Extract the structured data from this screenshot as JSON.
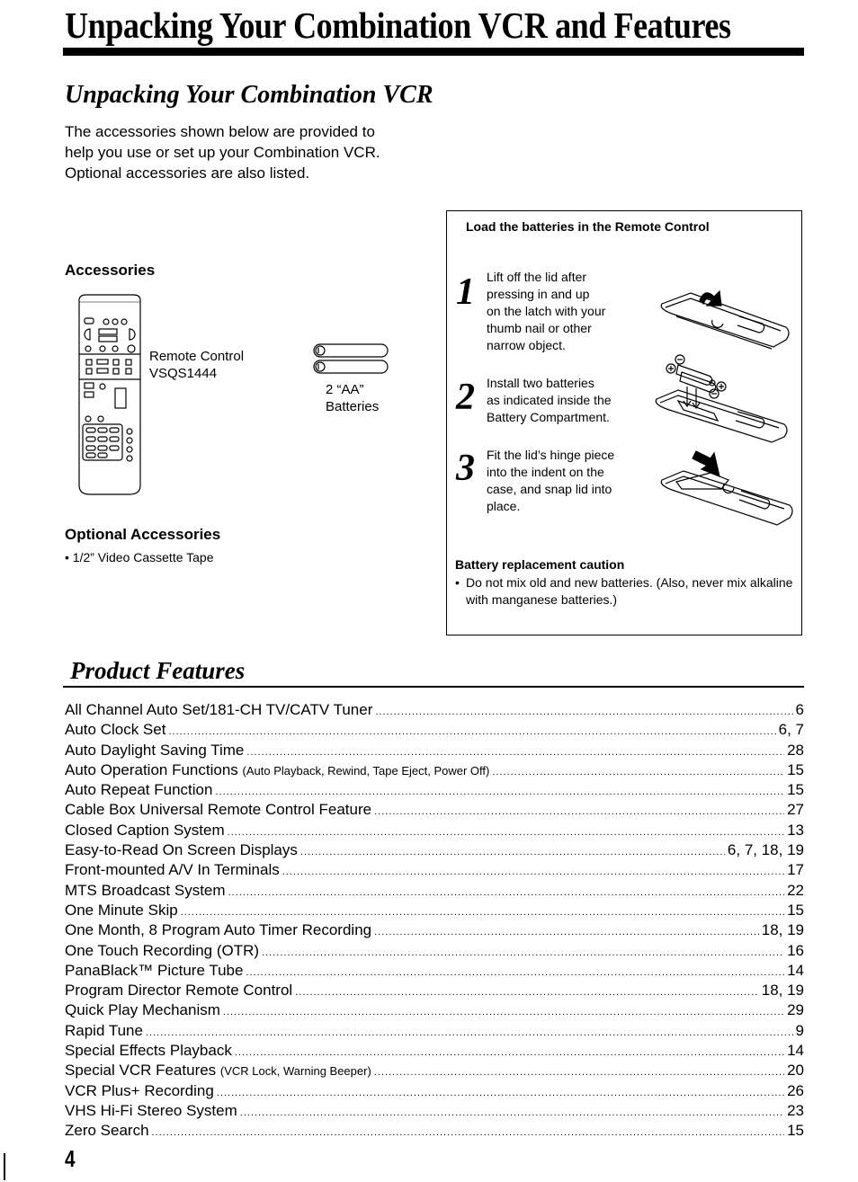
{
  "page": {
    "title": "Unpacking Your Combination VCR and Features",
    "page_number": "4"
  },
  "unpacking": {
    "heading": "Unpacking Your Combination VCR",
    "intro_lines": [
      "The accessories shown below are provided to",
      "help you use or set up your Combination VCR.",
      "Optional accessories are also listed."
    ],
    "accessories_heading": "Accessories",
    "remote": {
      "name": "Remote Control",
      "model": "VSQS1444",
      "icon": "remote-control-illustration"
    },
    "batteries": {
      "count_label": "2 “AA”",
      "label": "Batteries",
      "icon": "aa-batteries-illustration"
    },
    "optional_heading": "Optional Accessories",
    "optional_items": [
      "1/2” Video Cassette Tape"
    ]
  },
  "battery_box": {
    "heading": "Load the batteries in the Remote Control",
    "steps": [
      {
        "number": "1",
        "lines": [
          "Lift off the lid after",
          "pressing in and up",
          "on the latch with your",
          "thumb nail or other",
          "narrow object."
        ],
        "icon": "remote-lid-lift-illustration"
      },
      {
        "number": "2",
        "lines": [
          "Install two batteries",
          "as indicated inside the",
          "Battery Compartment."
        ],
        "icon": "battery-insert-illustration"
      },
      {
        "number": "3",
        "lines": [
          "Fit the lid’s hinge piece",
          "into the indent on the",
          "case, and snap lid into",
          "place."
        ],
        "icon": "remote-lid-close-illustration"
      }
    ],
    "caution_heading": "Battery replacement caution",
    "caution_items": [
      "Do not mix old and new batteries.  (Also, never mix alkaline with manganese batteries.)"
    ]
  },
  "features": {
    "heading": "Product Features",
    "items": [
      {
        "name": "All Channel Auto Set/181-CH TV/CATV Tuner",
        "sub": "",
        "pages": "6"
      },
      {
        "name": "Auto Clock Set",
        "sub": "",
        "pages": "6, 7"
      },
      {
        "name": "Auto Daylight Saving Time",
        "sub": "",
        "pages": "28"
      },
      {
        "name": "Auto Operation Functions",
        "sub": "(Auto Playback, Rewind, Tape Eject, Power Off)",
        "pages": "15"
      },
      {
        "name": "Auto Repeat Function",
        "sub": "",
        "pages": "15"
      },
      {
        "name": "Cable Box Universal Remote Control Feature",
        "sub": "",
        "pages": "27"
      },
      {
        "name": "Closed Caption System",
        "sub": "",
        "pages": "13"
      },
      {
        "name": "Easy-to-Read On Screen Displays",
        "sub": "",
        "pages": "6, 7, 18, 19"
      },
      {
        "name": "Front-mounted A/V In Terminals",
        "sub": "",
        "pages": "17"
      },
      {
        "name": "MTS Broadcast System",
        "sub": "",
        "pages": "22"
      },
      {
        "name": "One Minute Skip",
        "sub": "",
        "pages": "15"
      },
      {
        "name": "One Month, 8 Program Auto Timer Recording",
        "sub": "",
        "pages": "18, 19"
      },
      {
        "name": "One Touch Recording (OTR)",
        "sub": "",
        "pages": "16"
      },
      {
        "name": "PanaBlack™ Picture Tube",
        "sub": "",
        "pages": "14"
      },
      {
        "name": "Program Director Remote Control",
        "sub": "",
        "pages": "18, 19"
      },
      {
        "name": "Quick Play Mechanism",
        "sub": "",
        "pages": "29"
      },
      {
        "name": "Rapid Tune",
        "sub": "",
        "pages": "9"
      },
      {
        "name": "Special Effects Playback",
        "sub": "",
        "pages": "14"
      },
      {
        "name": "Special VCR Features",
        "sub": "(VCR Lock, Warning Beeper)",
        "pages": "20"
      },
      {
        "name": "VCR Plus+ Recording",
        "sub": "",
        "pages": "26"
      },
      {
        "name": "VHS Hi-Fi Stereo System",
        "sub": "",
        "pages": "23"
      },
      {
        "name": "Zero Search",
        "sub": "",
        "pages": "15"
      }
    ]
  }
}
